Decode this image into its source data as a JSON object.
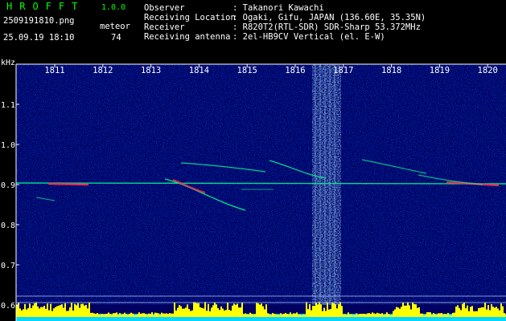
{
  "header": {
    "app_title": "HROFFT",
    "app_version": "1.0.0",
    "file_name": "2509191810.png",
    "timestamp": "25.09.19 18:10",
    "meteor_label": "meteor",
    "meteor_count": "74"
  },
  "info": [
    {
      "key": "Observer",
      "value": ": Takanori Kawachi"
    },
    {
      "key": "Receiving Location",
      "value": ": Ogaki, Gifu, JAPAN (136.60E, 35.35N)"
    },
    {
      "key": "Receiver",
      "value": ": R820T2(RTL-SDR) SDR-Sharp 53.372MHz"
    },
    {
      "key": "Receiving antenna",
      "value": ": 2el-HB9CV Vertical (el. E-W)"
    }
  ],
  "chart_data": {
    "type": "heatmap",
    "ylabel": "kHz",
    "ylim": [
      0.6,
      1.2
    ],
    "y_ticks": [
      "1.1",
      "1.0",
      "0.9",
      "0.8",
      "0.7",
      "0.6"
    ],
    "x_ticks": [
      "1811",
      "1812",
      "1813",
      "1814",
      "1815",
      "1816",
      "1817",
      "1818",
      "1819",
      "1820"
    ],
    "grid": true,
    "colors": {
      "background": "#000060",
      "noise": "#0022ff",
      "echo": "#00ff90",
      "strong": "#ff3050",
      "axis": "#ffffff",
      "level": "#ffff00",
      "baseline": "#00d8ff"
    }
  }
}
